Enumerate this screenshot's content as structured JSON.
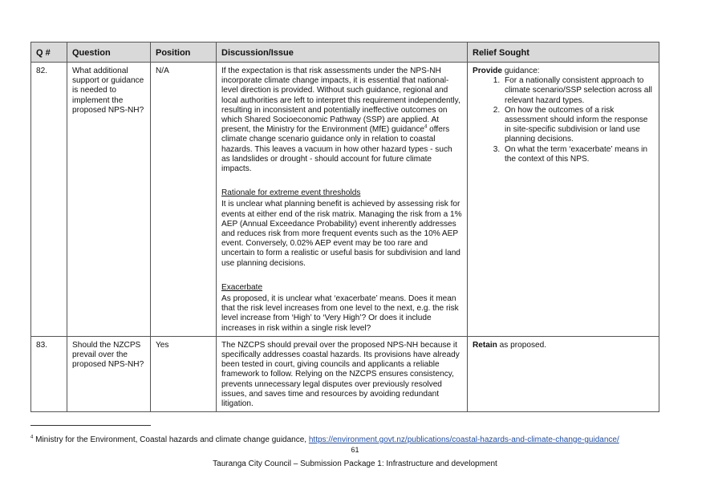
{
  "table": {
    "headers": {
      "q": "Q #",
      "question": "Question",
      "position": "Position",
      "discussion": "Discussion/Issue",
      "relief": "Relief Sought"
    },
    "rows": [
      {
        "q": "82.",
        "question": "What additional support or guidance is needed to implement the proposed NPS-NH?",
        "position": "N/A",
        "discussion": {
          "intro_before_sup": "If the expectation is that risk assessments under the NPS-NH incorporate climate change impacts, it is essential that national-level direction is provided. Without such guidance, regional and local authorities are left to interpret this requirement independently, resulting in inconsistent and potentially ineffective outcomes on which Shared Socioeconomic Pathway (SSP) are applied. At present, the Ministry for the Environment (MfE) guidance",
          "footnote_ref": "4",
          "intro_after_sup": " offers climate change scenario guidance only in relation to coastal hazards. This leaves a vacuum in how other hazard types - such as landslides or drought - should account for future climate impacts.",
          "section1_heading": "Rationale for extreme event thresholds",
          "section1_text": "It is unclear what planning benefit is achieved by assessing risk for events at either end of the risk matrix. Managing the risk from a 1% AEP (Annual Exceedance Probability) event inherently addresses and reduces risk from more frequent events such as the 10% AEP event. Conversely, 0.02% AEP event may be too rare and uncertain to form a realistic or useful basis for subdivision and land use planning decisions.",
          "section2_heading": "Exacerbate",
          "section2_text": "As proposed, it is unclear what ‘exacerbate’ means. Does it mean that the risk level increases from one level to the next, e.g. the risk level increase from ‘High’ to ‘Very High’? Or does it include increases in risk within a single risk level?"
        },
        "relief": {
          "bold": "Provide",
          "rest": " guidance:",
          "items": [
            "For a nationally consistent approach to climate scenario/SSP selection across all relevant hazard types.",
            "On how the outcomes of a risk assessment should inform the response in site-specific subdivision or land use planning decisions.",
            "On what the term ‘exacerbate’ means in the context of this NPS."
          ]
        }
      },
      {
        "q": "83.",
        "question": "Should the NZCPS prevail over the proposed NPS-NH?",
        "position": "Yes",
        "discussion": "The NZCPS should prevail over the proposed NPS-NH because it specifically addresses coastal hazards. Its provisions have already been tested in court, giving councils and applicants a reliable framework to follow. Relying on the NZCPS ensures consistency, prevents unnecessary legal disputes over previously resolved issues, and saves time and resources by avoiding redundant litigation.",
        "relief": {
          "bold": "Retain",
          "rest": " as proposed."
        }
      }
    ]
  },
  "footnote": {
    "number": "4",
    "text": " Ministry for the Environment, Coastal hazards and climate change guidance, ",
    "link": "https://environment.govt.nz/publications/coastal-hazards-and-climate-change-guidance/"
  },
  "page_number": "61",
  "footer": "Tauranga City Council – Submission Package 1: Infrastructure and development"
}
